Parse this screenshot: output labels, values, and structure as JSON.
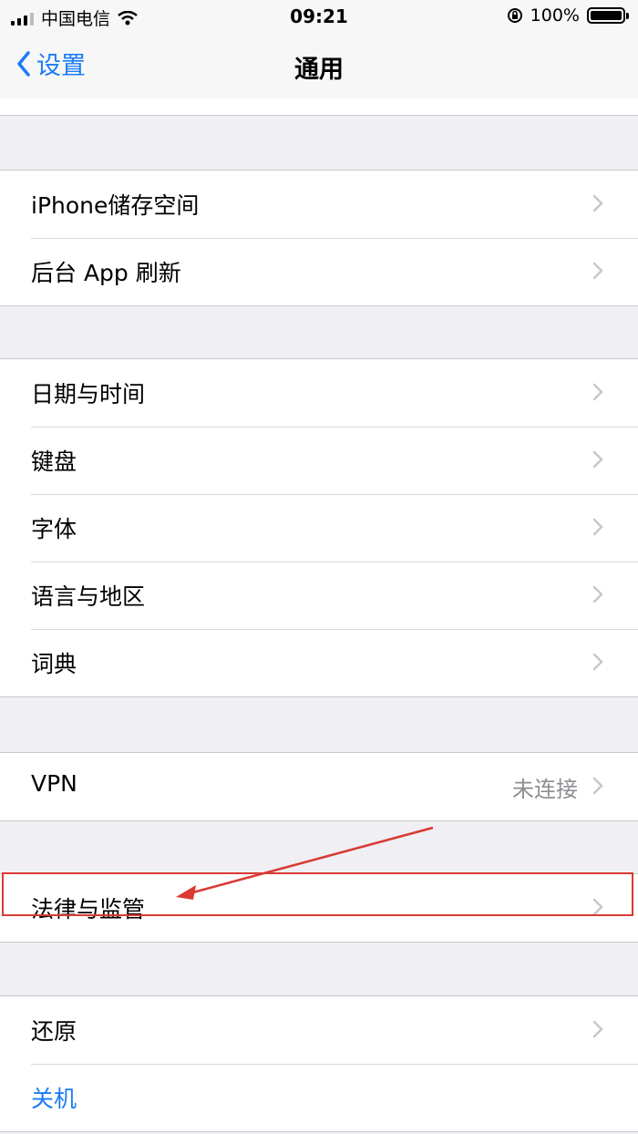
{
  "status_bar": {
    "carrier": "中国电信",
    "time": "09:21",
    "battery_percent": "100%"
  },
  "nav": {
    "back_label": "设置",
    "title": "通用"
  },
  "groups": [
    {
      "items": [
        {
          "label": "iPhone储存空间"
        },
        {
          "label": "后台 App 刷新"
        }
      ]
    },
    {
      "items": [
        {
          "label": "日期与时间"
        },
        {
          "label": "键盘"
        },
        {
          "label": "字体"
        },
        {
          "label": "语言与地区"
        },
        {
          "label": "词典"
        }
      ]
    },
    {
      "items": [
        {
          "label": "VPN",
          "detail": "未连接"
        }
      ]
    },
    {
      "items": [
        {
          "label": "法律与监管"
        }
      ]
    },
    {
      "items": [
        {
          "label": "还原"
        },
        {
          "label": "关机"
        }
      ]
    }
  ],
  "colors": {
    "accent": "#1a7cf5",
    "annotation": "#d93a32",
    "background": "#efeff4"
  }
}
